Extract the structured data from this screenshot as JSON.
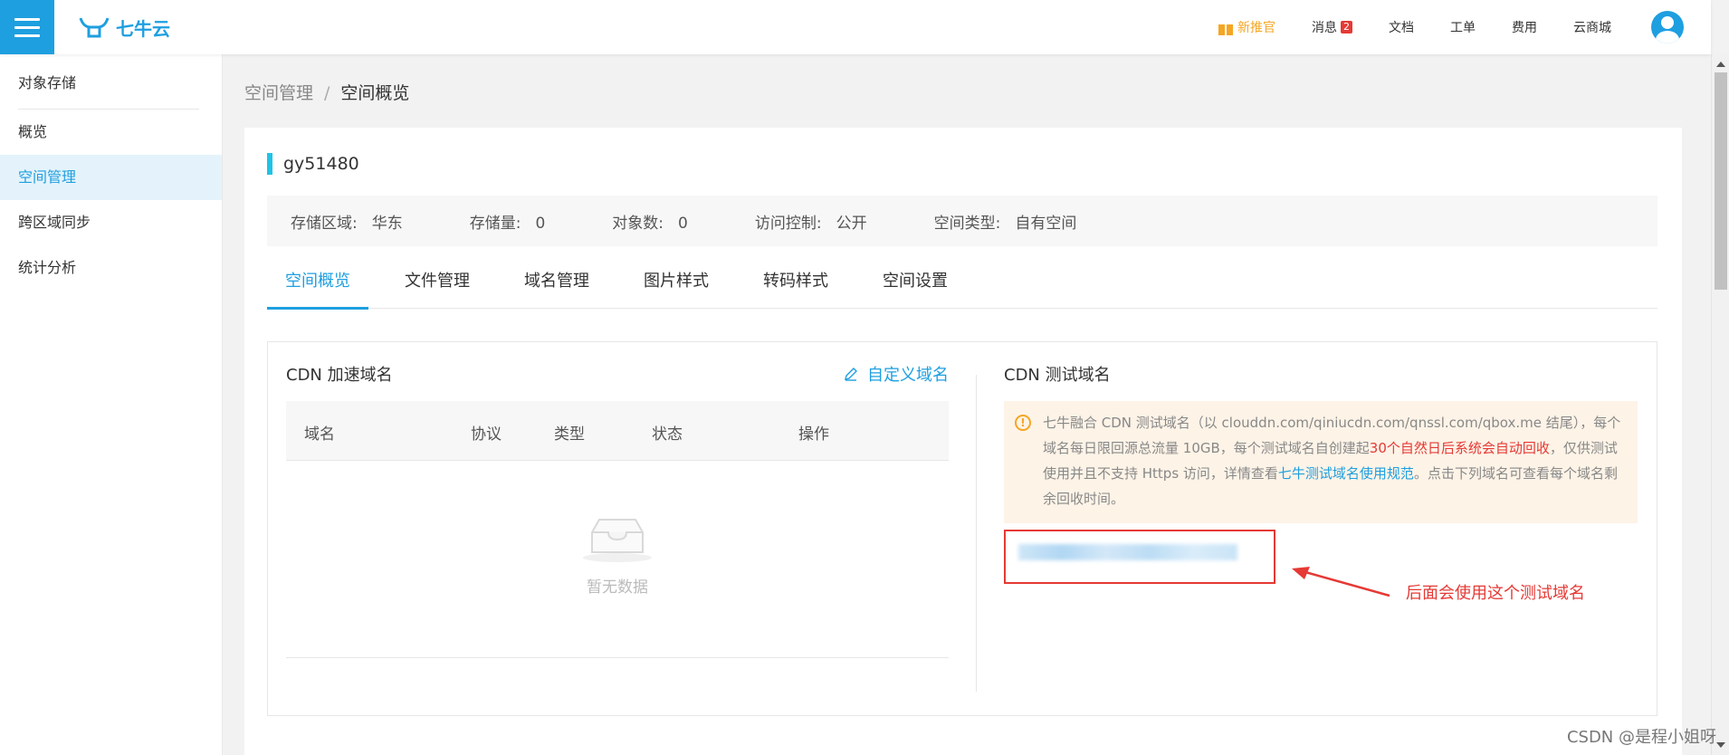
{
  "topbar": {
    "logo_text": "七牛云",
    "nav": {
      "new": "新推官",
      "messages": "消息",
      "messages_badge": "2",
      "docs": "文档",
      "tickets": "工单",
      "billing": "费用",
      "marketplace": "云商城"
    }
  },
  "sidebar": {
    "header": "对象存储",
    "items": [
      {
        "label": "概览"
      },
      {
        "label": "空间管理"
      },
      {
        "label": "跨区域同步"
      },
      {
        "label": "统计分析"
      }
    ],
    "active_index": 1
  },
  "breadcrumb": {
    "parent": "空间管理",
    "separator": "/",
    "current": "空间概览"
  },
  "bucket": {
    "name": "gy51480",
    "info": {
      "region_label": "存储区域:",
      "region_value": "华东",
      "storage_label": "存储量:",
      "storage_value": "0",
      "objects_label": "对象数:",
      "objects_value": "0",
      "access_label": "访问控制:",
      "access_value": "公开",
      "type_label": "空间类型:",
      "type_value": "自有空间"
    }
  },
  "tabs": [
    {
      "label": "空间概览"
    },
    {
      "label": "文件管理"
    },
    {
      "label": "域名管理"
    },
    {
      "label": "图片样式"
    },
    {
      "label": "转码样式"
    },
    {
      "label": "空间设置"
    }
  ],
  "cdn_domain": {
    "title": "CDN 加速域名",
    "custom_link": "自定义域名",
    "columns": [
      "域名",
      "协议",
      "类型",
      "状态",
      "操作"
    ],
    "empty_text": "暂无数据"
  },
  "cdn_test": {
    "title": "CDN 测试域名",
    "notice_part1": "七牛融合 CDN 测试域名（以 clouddn.com/qiniucdn.com/qnssl.com/qbox.me 结尾），每个域名每日限回源总流量 10GB，每个测试域名自创建起",
    "notice_red": "30个自然日后系统会自动回收",
    "notice_part2": "，仅供测试使用并且不支持 Https 访问，详情查看",
    "notice_link": "七牛测试域名使用规范",
    "notice_part3": "。点击下列域名可查看每个域名剩余回收时间。"
  },
  "annotation": "后面会使用这个测试域名",
  "watermark": "CSDN @是程小姐呀",
  "colors": {
    "accent": "#1e9fe0",
    "warning": "#f5a623",
    "alert": "#e53935"
  }
}
